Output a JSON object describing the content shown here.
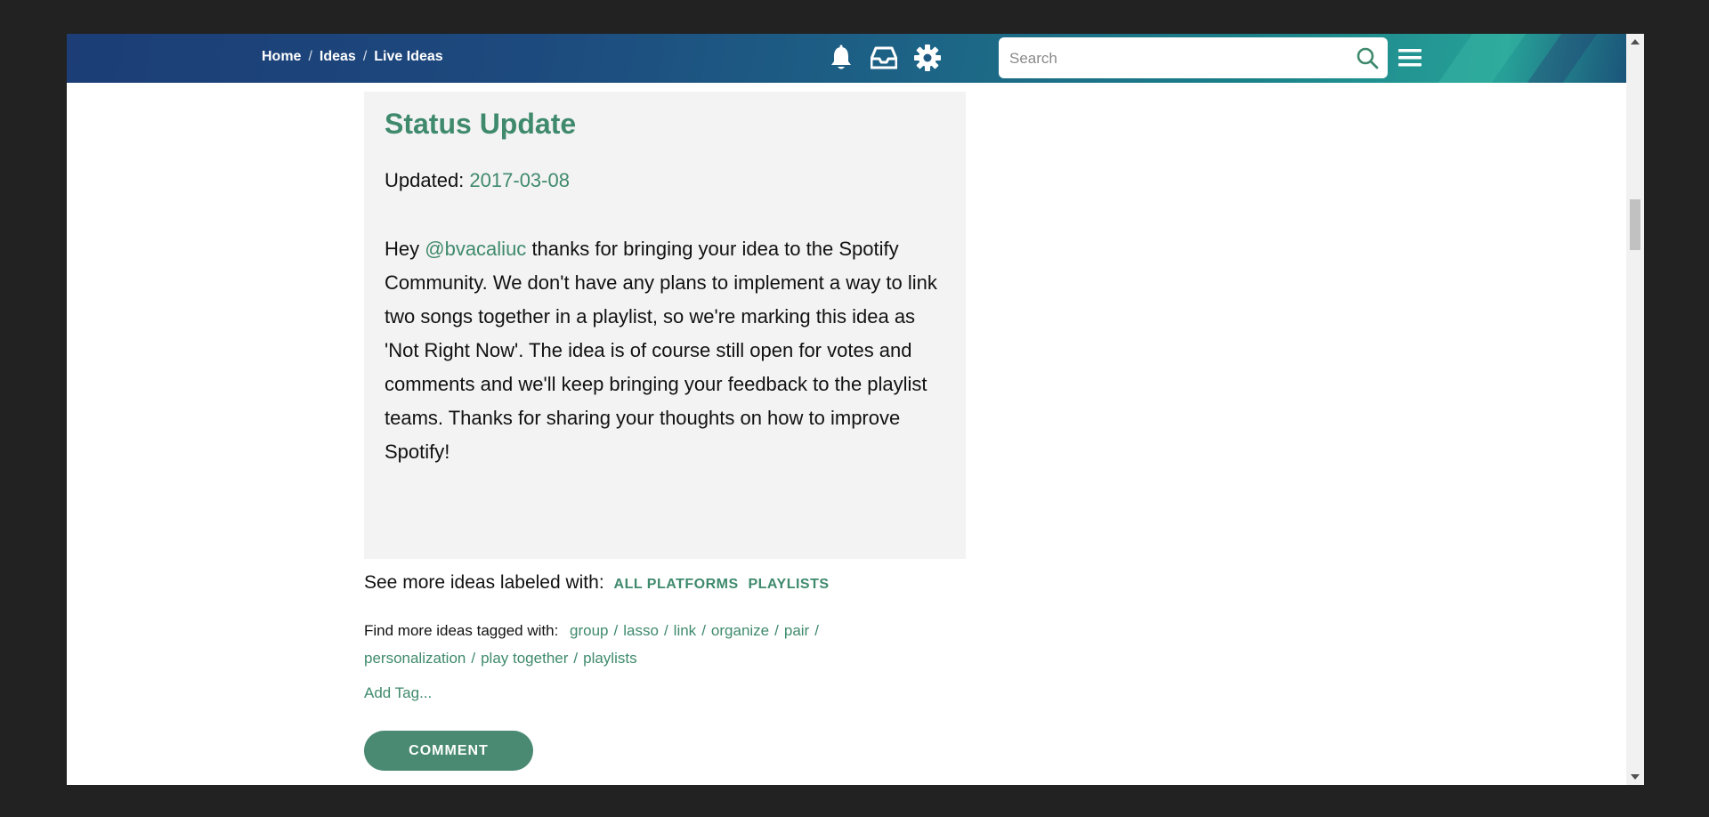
{
  "breadcrumb": {
    "items": [
      "Home",
      "Ideas",
      "Live Ideas"
    ],
    "separator": "/"
  },
  "header": {
    "icons": [
      "bell-icon",
      "inbox-icon",
      "gear-icon",
      "menu-icon"
    ],
    "search": {
      "placeholder": "Search",
      "value": ""
    }
  },
  "status": {
    "title": "Status Update",
    "updated_label": "Updated:",
    "updated_date": "2017-03-08",
    "body_prefix": "Hey",
    "mention": "@bvacaliuc",
    "body_text": "thanks for bringing your idea to the Spotify Community. We don't have any plans to implement a way to link two songs together in a playlist, so we're marking this idea as 'Not Right Now'. The idea is of course still open for votes and comments and we'll keep bringing your feedback to the playlist teams. Thanks for sharing your thoughts on how to improve Spotify!"
  },
  "labels": {
    "prefix": "See more ideas labeled with:",
    "items": [
      "ALL PLATFORMS",
      "PLAYLISTS"
    ]
  },
  "tags": {
    "prefix": "Find more ideas tagged with:",
    "items": [
      "group",
      "lasso",
      "link",
      "organize",
      "pair",
      "personalization",
      "play together",
      "playlists"
    ],
    "separator": "/"
  },
  "add_tag_label": "Add Tag...",
  "comment_label": "COMMENT",
  "colors": {
    "accent": "#3f8a6d",
    "button": "#4a8a73",
    "status_bg": "#f3f3f3"
  }
}
